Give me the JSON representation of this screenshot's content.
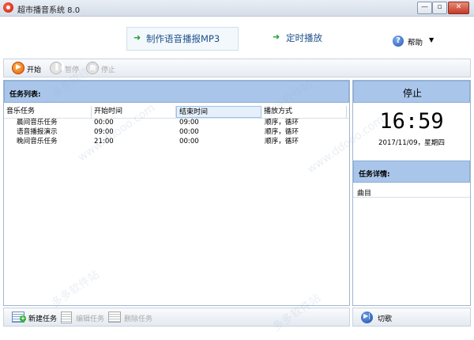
{
  "window": {
    "title": "超市播音系统 8.0",
    "controls": [
      "—",
      "▫",
      "✕"
    ]
  },
  "nav": {
    "items": [
      {
        "label": "制作语音播报MP3"
      },
      {
        "label": "定时播放"
      }
    ],
    "help_label": "帮助"
  },
  "toolbar": {
    "start": "开始",
    "pause": "暂停",
    "stop": "停止"
  },
  "task_list": {
    "title": "任务列表:",
    "columns": [
      "音乐任务",
      "开始时间",
      "结束时间",
      "播放方式"
    ],
    "rows": [
      [
        "晨间音乐任务",
        "00:00",
        "09:00",
        "顺序，循环"
      ],
      [
        "语音播报演示",
        "09:00",
        "00:00",
        "顺序，循环"
      ],
      [
        "晚间音乐任务",
        "21:00",
        "00:00",
        "顺序，循环"
      ]
    ]
  },
  "status": {
    "state": "停止",
    "time": "16:59",
    "date": "2017/11/09，星期四"
  },
  "task_detail": {
    "title": "任务详情:",
    "column": "曲目"
  },
  "bottom_left": {
    "new_task": "新建任务",
    "edit_task": "编辑任务",
    "delete_task": "删除任务"
  },
  "bottom_right": {
    "switch": "切歌"
  },
  "watermarks": [
    "多多软件站",
    "www.ddooo.com"
  ]
}
